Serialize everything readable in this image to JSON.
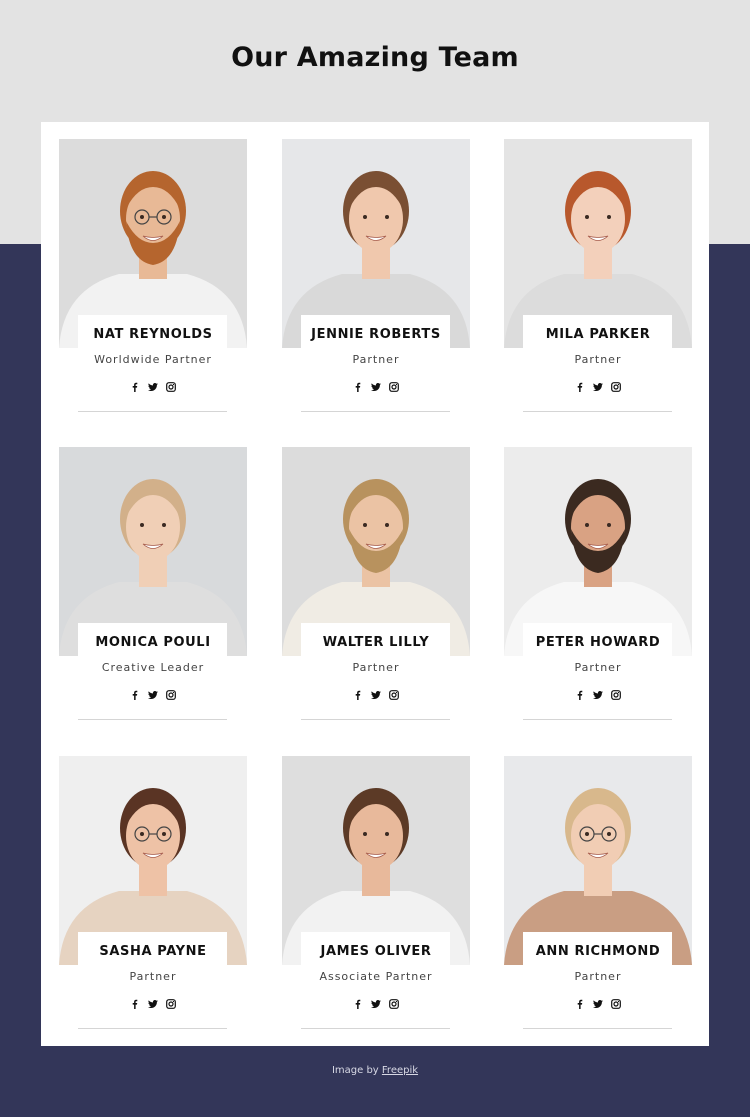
{
  "page": {
    "title": "Our Amazing Team",
    "colors": {
      "top_background": "#e3e3e3",
      "bottom_background": "#333659",
      "panel": "#ffffff",
      "text": "#111111"
    }
  },
  "members": [
    {
      "name": "NAT REYNOLDS",
      "role": "Worldwide Partner",
      "photo": {
        "bg": "#dcdcdc",
        "hair": "#b5652e",
        "skin": "#e8b996",
        "shirt": "#f2f2f2",
        "beard": true,
        "glasses": true
      }
    },
    {
      "name": "JENNIE ROBERTS",
      "role": "Partner",
      "photo": {
        "bg": "#e6e7e9",
        "hair": "#7a4f33",
        "skin": "#f0c8ad",
        "shirt": "#d9d9d9",
        "beard": false,
        "glasses": false
      }
    },
    {
      "name": "MILA PARKER",
      "role": "Partner",
      "photo": {
        "bg": "#e4e4e4",
        "hair": "#b8582c",
        "skin": "#f3d0bb",
        "shirt": "#dcdcdc",
        "beard": false,
        "glasses": false
      }
    },
    {
      "name": "MONICA POULI",
      "role": "Creative Leader",
      "photo": {
        "bg": "#d8dadc",
        "hair": "#d2b08a",
        "skin": "#f0cfb6",
        "shirt": "#dedede",
        "beard": false,
        "glasses": false
      }
    },
    {
      "name": "WALTER LILLY",
      "role": "Partner",
      "photo": {
        "bg": "#dcdcdc",
        "hair": "#b8925e",
        "skin": "#ebc3a4",
        "shirt": "#f0ece4",
        "beard": true,
        "glasses": false
      }
    },
    {
      "name": "PETER HOWARD",
      "role": "Partner",
      "photo": {
        "bg": "#ececec",
        "hair": "#3b2a20",
        "skin": "#d9a283",
        "shirt": "#f7f7f7",
        "beard": true,
        "glasses": false
      }
    },
    {
      "name": "SASHA PAYNE",
      "role": "Partner",
      "photo": {
        "bg": "#efefef",
        "hair": "#5a3424",
        "skin": "#eec2a6",
        "shirt": "#e6d3c1",
        "beard": false,
        "glasses": true
      }
    },
    {
      "name": "JAMES OLIVER",
      "role": "Associate Partner",
      "photo": {
        "bg": "#dedede",
        "hair": "#5c3a26",
        "skin": "#e8b99b",
        "shirt": "#f2f2f2",
        "beard": false,
        "glasses": false
      }
    },
    {
      "name": "ANN RICHMOND",
      "role": "Partner",
      "photo": {
        "bg": "#e8e9eb",
        "hair": "#d8b88c",
        "skin": "#f1cdb4",
        "shirt": "#c99e83",
        "beard": false,
        "glasses": true
      }
    }
  ],
  "socials": [
    {
      "icon": "facebook-icon",
      "label": "f"
    },
    {
      "icon": "twitter-icon",
      "label": "twitter"
    },
    {
      "icon": "instagram-icon",
      "label": "instagram"
    }
  ],
  "footer": {
    "credit_prefix": "Image by ",
    "credit_link": "Freepik"
  }
}
